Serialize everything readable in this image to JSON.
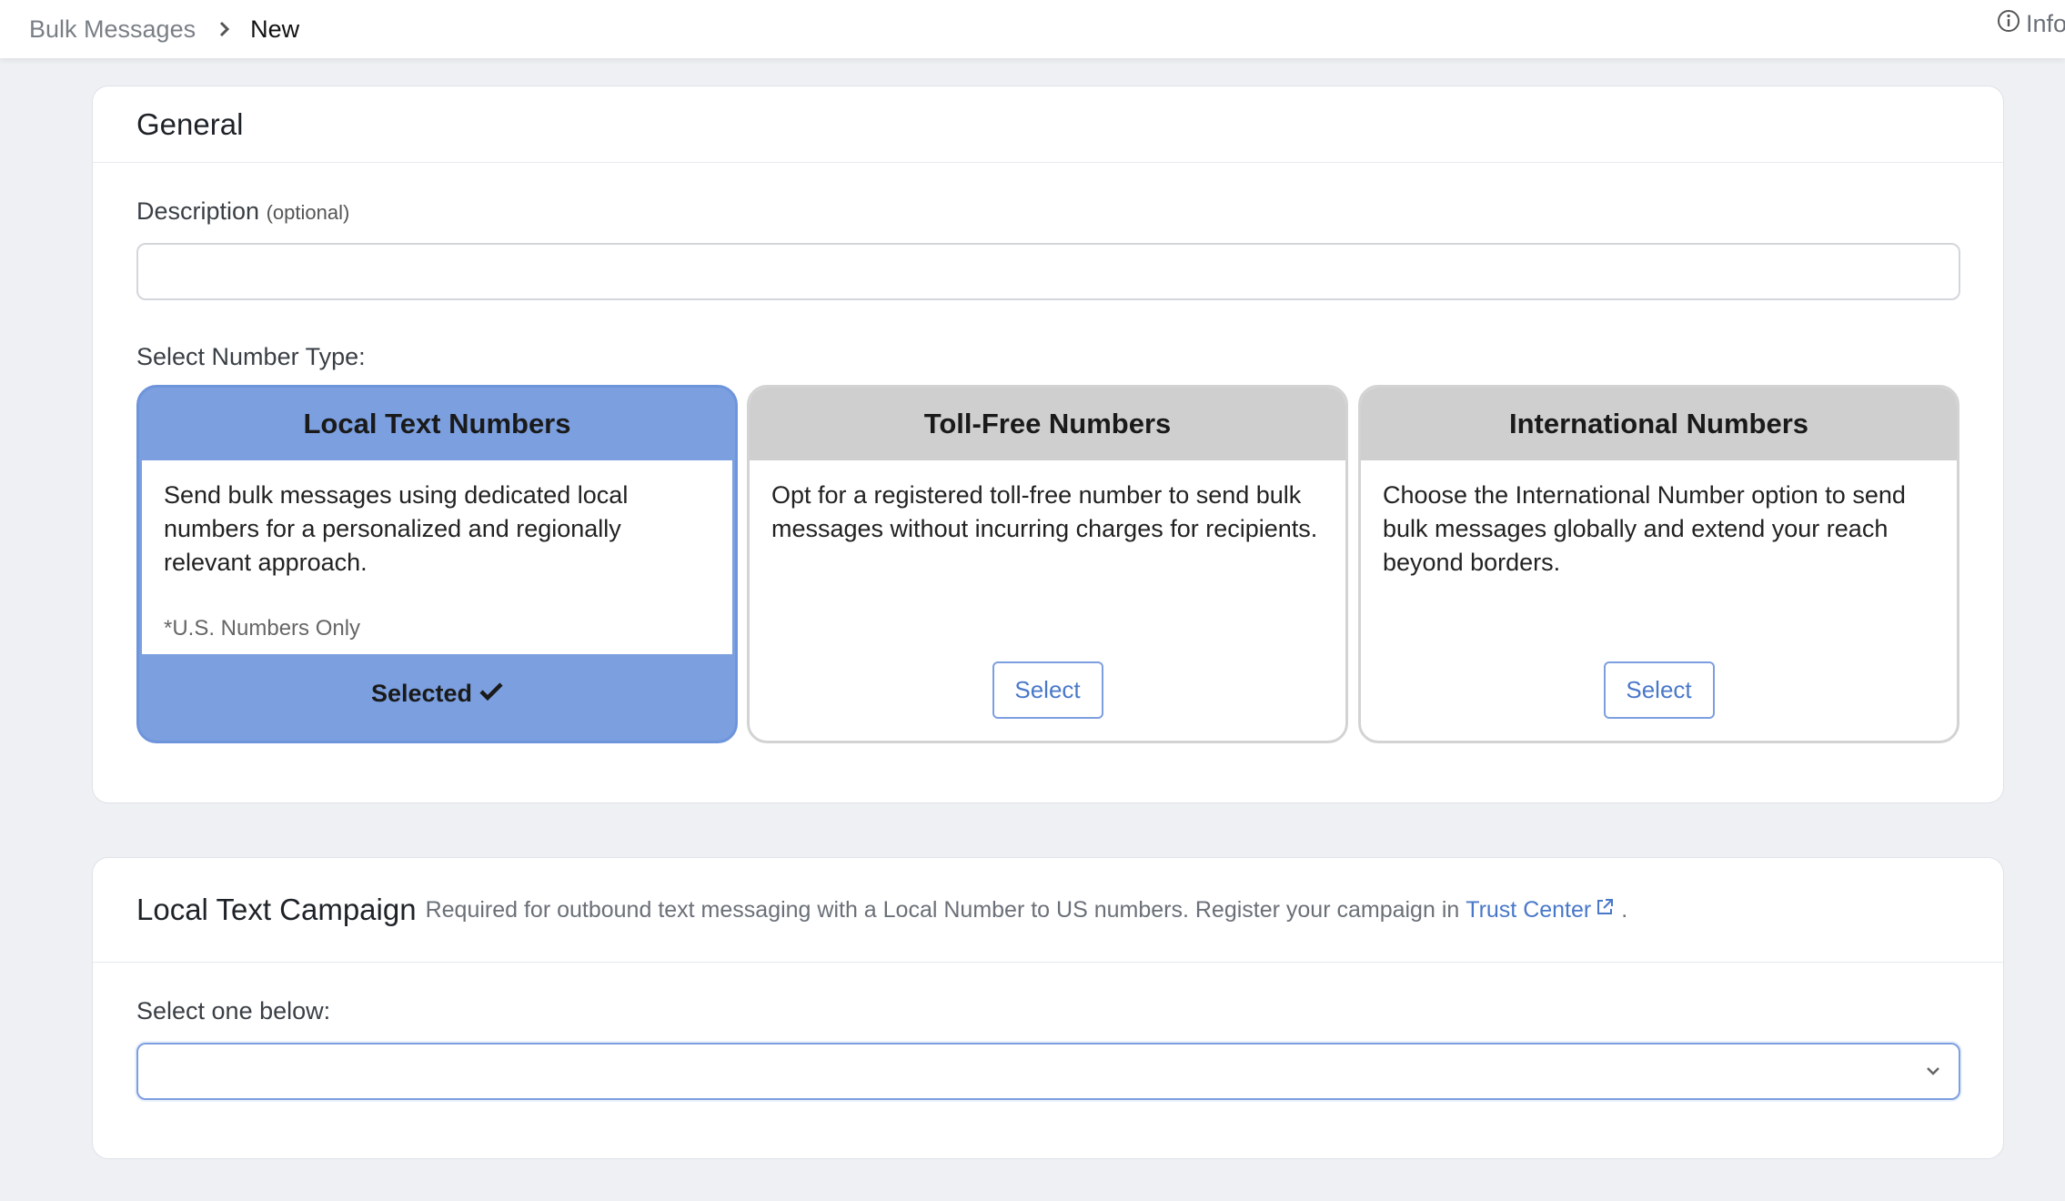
{
  "breadcrumb": {
    "parent": "Bulk Messages",
    "current": "New"
  },
  "header": {
    "info_label": "Info"
  },
  "general": {
    "title": "General",
    "description_label": "Description",
    "description_optional": "(optional)",
    "description_value": "",
    "number_type_label": "Select Number Type:",
    "number_types": [
      {
        "title": "Local Text Numbers",
        "description": "Send bulk messages using dedicated local numbers for a personalized and regionally relevant approach.",
        "note": "*U.S. Numbers Only",
        "selected": true,
        "selected_label": "Selected"
      },
      {
        "title": "Toll-Free Numbers",
        "description": "Opt for a registered toll-free number to send bulk messages without incurring charges for recipients.",
        "selected": false,
        "button_label": "Select"
      },
      {
        "title": "International Numbers",
        "description": "Choose the International Number option to send bulk messages globally and extend your reach beyond borders.",
        "selected": false,
        "button_label": "Select"
      }
    ]
  },
  "campaign": {
    "title": "Local Text Campaign",
    "subtitle": "Required for outbound text messaging with a Local Number to US numbers. Register your campaign in",
    "link_label": "Trust Center",
    "subtitle_end": ".",
    "select_label": "Select one below:",
    "select_value": ""
  },
  "colors": {
    "accent": "#7b9fdf",
    "link": "#4a78c9",
    "card_header_inactive": "#cfcfcf"
  },
  "icons": [
    "chevron-right-icon",
    "info-circle-icon",
    "check-icon",
    "external-link-icon",
    "chevron-down-icon"
  ]
}
